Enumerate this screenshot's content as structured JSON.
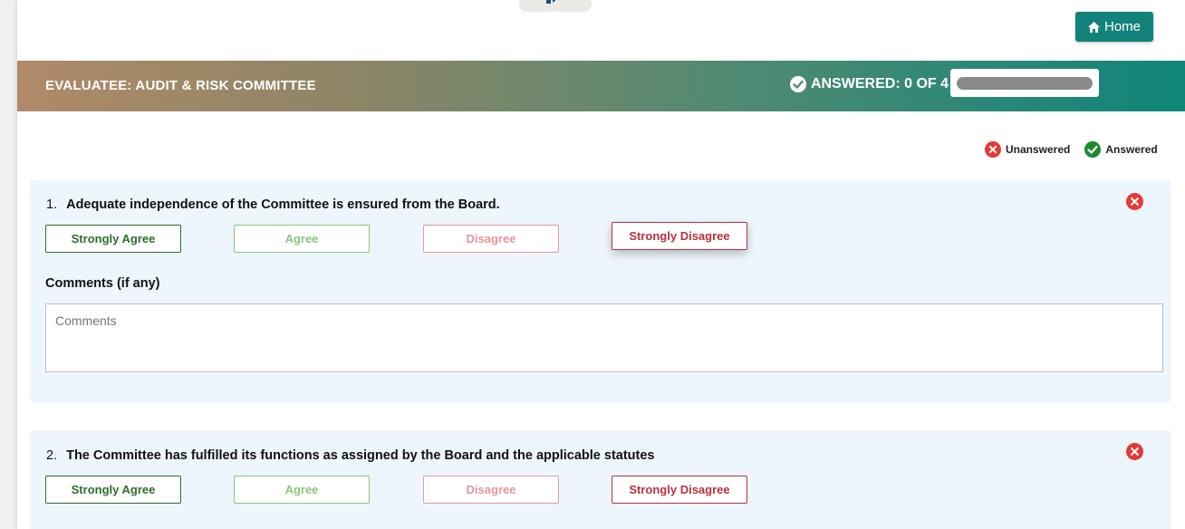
{
  "header": {
    "home_label": "Home"
  },
  "banner": {
    "evaluatee": "EVALUATEE: AUDIT & RISK COMMITTEE",
    "answered": "ANSWERED: 0 OF 4",
    "progress": 0
  },
  "legend": {
    "unanswered": "Unanswered",
    "answered": "Answered"
  },
  "questions": [
    {
      "number": "1.",
      "text": "Adequate independence of the Committee is ensured from the Board.",
      "options": [
        "Strongly Agree",
        "Agree",
        "Disagree",
        "Strongly Disagree"
      ],
      "comments_label": "Comments (if any)",
      "comments_placeholder": "Comments"
    },
    {
      "number": "2.",
      "text": "The Committee has fulfilled its functions as assigned by the Board and the applicable statutes",
      "options": [
        "Strongly Agree",
        "Agree",
        "Disagree",
        "Strongly Disagree"
      ]
    }
  ],
  "colors": {
    "accent": "#12827a",
    "unanswered": "#e53935",
    "answered": "#1e8a2e",
    "strongly_agree": "#2e6e2a",
    "agree": "#86c77c",
    "disagree": "#e8969a",
    "strongly_disagree": "#b8313a"
  },
  "icons": {
    "home": "home-icon",
    "answered": "check-circle-icon",
    "unanswered": "x-circle-icon"
  }
}
